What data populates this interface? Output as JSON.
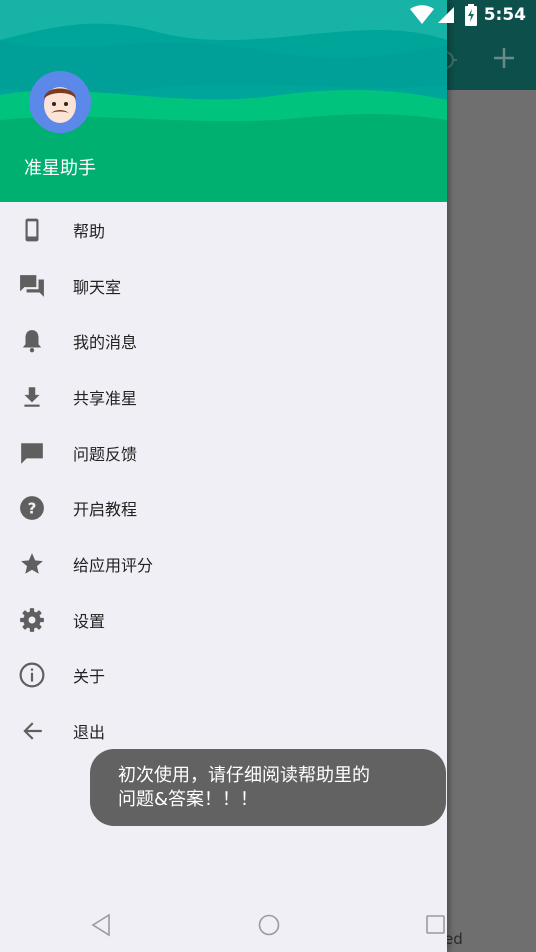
{
  "status_bar": {
    "time": "5:54"
  },
  "drawer": {
    "app_name": "准星助手",
    "menu": [
      {
        "label": "帮助",
        "icon": "phone-icon"
      },
      {
        "label": "聊天室",
        "icon": "chat-icon"
      },
      {
        "label": "我的消息",
        "icon": "bell-icon"
      },
      {
        "label": "共享准星",
        "icon": "download-icon"
      },
      {
        "label": "问题反馈",
        "icon": "feedback-icon"
      },
      {
        "label": "开启教程",
        "icon": "help-icon"
      },
      {
        "label": "给应用评分",
        "icon": "star-icon"
      },
      {
        "label": "设置",
        "icon": "gear-icon"
      },
      {
        "label": "关于",
        "icon": "info-icon"
      },
      {
        "label": "退出",
        "icon": "arrow-back-icon"
      }
    ]
  },
  "toast": {
    "line1": "初次使用，请仔细阅读帮助里的",
    "line2": "问题&答案！！！"
  },
  "background_app": {
    "partial_text": "ed"
  },
  "colors": {
    "header_green": "#00b070",
    "icon_grey": "#5f5f5f",
    "toast_bg": "#626262"
  }
}
